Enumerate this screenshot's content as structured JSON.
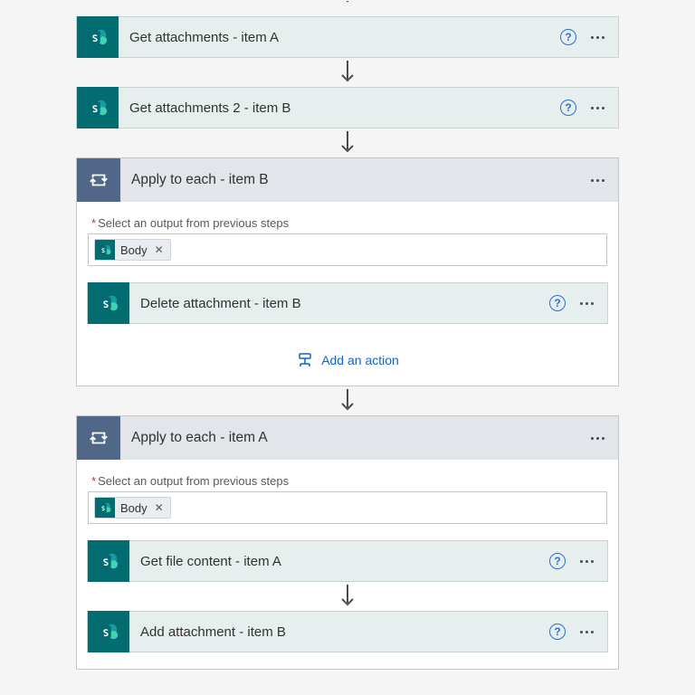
{
  "actions": {
    "getA": {
      "title": "Get attachments - item A"
    },
    "getB": {
      "title": "Get attachments 2 - item B"
    }
  },
  "loopB": {
    "title": "Apply to each - item B",
    "fieldLabel": "Select an output from previous steps",
    "token": "Body",
    "inner": {
      "title": "Delete attachment - item B"
    },
    "addAction": "Add an action"
  },
  "loopA": {
    "title": "Apply to each - item A",
    "fieldLabel": "Select an output from previous steps",
    "token": "Body",
    "inner1": {
      "title": "Get file content - item A"
    },
    "inner2": {
      "title": "Add attachment - item B"
    }
  }
}
